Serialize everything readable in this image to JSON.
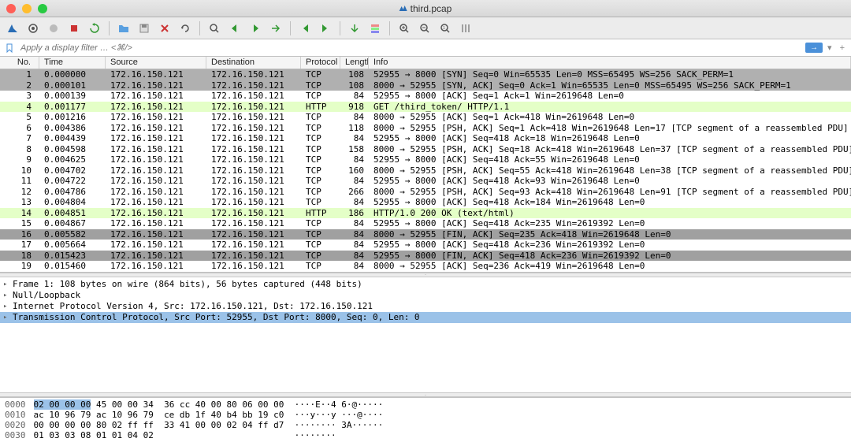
{
  "window": {
    "title": "third.pcap"
  },
  "filter": {
    "placeholder": "Apply a display filter … <⌘/>"
  },
  "toolbar_icons": [
    "shark-fin-icon",
    "capture-options-icon",
    "capture-start-icon",
    "capture-stop-icon",
    "capture-restart-icon",
    "sep",
    "file-open-icon",
    "file-save-icon",
    "file-close-icon",
    "reload-icon",
    "sep",
    "find-icon",
    "go-back-icon",
    "go-forward-icon",
    "go-to-icon",
    "sep",
    "go-first-icon",
    "go-last-icon",
    "sep",
    "auto-scroll-icon",
    "colorize-icon",
    "sep",
    "zoom-in-icon",
    "zoom-out-icon",
    "zoom-reset-icon",
    "resize-columns-icon"
  ],
  "columns": {
    "no": "No.",
    "time": "Time",
    "src": "Source",
    "dst": "Destination",
    "proto": "Protocol",
    "len": "Length",
    "info": "Info"
  },
  "packets": [
    {
      "no": 1,
      "time": "0.000000",
      "src": "172.16.150.121",
      "dst": "172.16.150.121",
      "proto": "TCP",
      "len": 108,
      "info": "52955 → 8000 [SYN] Seq=0 Win=65535 Len=0 MSS=65495 WS=256 SACK_PERM=1",
      "cls": "syn"
    },
    {
      "no": 2,
      "time": "0.000101",
      "src": "172.16.150.121",
      "dst": "172.16.150.121",
      "proto": "TCP",
      "len": 108,
      "info": "8000 → 52955 [SYN, ACK] Seq=0 Ack=1 Win=65535 Len=0 MSS=65495 WS=256 SACK_PERM=1",
      "cls": "syn"
    },
    {
      "no": 3,
      "time": "0.000139",
      "src": "172.16.150.121",
      "dst": "172.16.150.121",
      "proto": "TCP",
      "len": 84,
      "info": "52955 → 8000 [ACK] Seq=1 Ack=1 Win=2619648 Len=0",
      "cls": "default"
    },
    {
      "no": 4,
      "time": "0.001177",
      "src": "172.16.150.121",
      "dst": "172.16.150.121",
      "proto": "HTTP",
      "len": 918,
      "info": "GET /third_token/ HTTP/1.1",
      "cls": "http"
    },
    {
      "no": 5,
      "time": "0.001216",
      "src": "172.16.150.121",
      "dst": "172.16.150.121",
      "proto": "TCP",
      "len": 84,
      "info": "8000 → 52955 [ACK] Seq=1 Ack=418 Win=2619648 Len=0",
      "cls": "default"
    },
    {
      "no": 6,
      "time": "0.004386",
      "src": "172.16.150.121",
      "dst": "172.16.150.121",
      "proto": "TCP",
      "len": 118,
      "info": "8000 → 52955 [PSH, ACK] Seq=1 Ack=418 Win=2619648 Len=17 [TCP segment of a reassembled PDU]",
      "cls": "default"
    },
    {
      "no": 7,
      "time": "0.004439",
      "src": "172.16.150.121",
      "dst": "172.16.150.121",
      "proto": "TCP",
      "len": 84,
      "info": "52955 → 8000 [ACK] Seq=418 Ack=18 Win=2619648 Len=0",
      "cls": "default"
    },
    {
      "no": 8,
      "time": "0.004598",
      "src": "172.16.150.121",
      "dst": "172.16.150.121",
      "proto": "TCP",
      "len": 158,
      "info": "8000 → 52955 [PSH, ACK] Seq=18 Ack=418 Win=2619648 Len=37 [TCP segment of a reassembled PDU]",
      "cls": "default"
    },
    {
      "no": 9,
      "time": "0.004625",
      "src": "172.16.150.121",
      "dst": "172.16.150.121",
      "proto": "TCP",
      "len": 84,
      "info": "52955 → 8000 [ACK] Seq=418 Ack=55 Win=2619648 Len=0",
      "cls": "default"
    },
    {
      "no": 10,
      "time": "0.004702",
      "src": "172.16.150.121",
      "dst": "172.16.150.121",
      "proto": "TCP",
      "len": 160,
      "info": "8000 → 52955 [PSH, ACK] Seq=55 Ack=418 Win=2619648 Len=38 [TCP segment of a reassembled PDU]",
      "cls": "default"
    },
    {
      "no": 11,
      "time": "0.004722",
      "src": "172.16.150.121",
      "dst": "172.16.150.121",
      "proto": "TCP",
      "len": 84,
      "info": "52955 → 8000 [ACK] Seq=418 Ack=93 Win=2619648 Len=0",
      "cls": "default"
    },
    {
      "no": 12,
      "time": "0.004786",
      "src": "172.16.150.121",
      "dst": "172.16.150.121",
      "proto": "TCP",
      "len": 266,
      "info": "8000 → 52955 [PSH, ACK] Seq=93 Ack=418 Win=2619648 Len=91 [TCP segment of a reassembled PDU]",
      "cls": "default"
    },
    {
      "no": 13,
      "time": "0.004804",
      "src": "172.16.150.121",
      "dst": "172.16.150.121",
      "proto": "TCP",
      "len": 84,
      "info": "52955 → 8000 [ACK] Seq=418 Ack=184 Win=2619648 Len=0",
      "cls": "default"
    },
    {
      "no": 14,
      "time": "0.004851",
      "src": "172.16.150.121",
      "dst": "172.16.150.121",
      "proto": "HTTP",
      "len": 186,
      "info": "HTTP/1.0 200 OK  (text/html)",
      "cls": "http"
    },
    {
      "no": 15,
      "time": "0.004867",
      "src": "172.16.150.121",
      "dst": "172.16.150.121",
      "proto": "TCP",
      "len": 84,
      "info": "52955 → 8000 [ACK] Seq=418 Ack=235 Win=2619392 Len=0",
      "cls": "default"
    },
    {
      "no": 16,
      "time": "0.005582",
      "src": "172.16.150.121",
      "dst": "172.16.150.121",
      "proto": "TCP",
      "len": 84,
      "info": "8000 → 52955 [FIN, ACK] Seq=235 Ack=418 Win=2619648 Len=0",
      "cls": "fin"
    },
    {
      "no": 17,
      "time": "0.005664",
      "src": "172.16.150.121",
      "dst": "172.16.150.121",
      "proto": "TCP",
      "len": 84,
      "info": "52955 → 8000 [ACK] Seq=418 Ack=236 Win=2619392 Len=0",
      "cls": "default"
    },
    {
      "no": 18,
      "time": "0.015423",
      "src": "172.16.150.121",
      "dst": "172.16.150.121",
      "proto": "TCP",
      "len": 84,
      "info": "52955 → 8000 [FIN, ACK] Seq=418 Ack=236 Win=2619392 Len=0",
      "cls": "fin"
    },
    {
      "no": 19,
      "time": "0.015460",
      "src": "172.16.150.121",
      "dst": "172.16.150.121",
      "proto": "TCP",
      "len": 84,
      "info": "8000 → 52955 [ACK] Seq=236 Ack=419 Win=2619648 Len=0",
      "cls": "default"
    }
  ],
  "details": [
    {
      "text": "Frame 1: 108 bytes on wire (864 bits), 56 bytes captured (448 bits)",
      "selected": false
    },
    {
      "text": "Null/Loopback",
      "selected": false
    },
    {
      "text": "Internet Protocol Version 4, Src: 172.16.150.121, Dst: 172.16.150.121",
      "selected": false
    },
    {
      "text": "Transmission Control Protocol, Src Port: 52955, Dst Port: 8000, Seq: 0, Len: 0",
      "selected": true
    }
  ],
  "bytes": {
    "rows": [
      {
        "addr": "0000",
        "hex_pre": "",
        "hex_sel": "02 00 00 00",
        "hex_post": " 45 00 00 34  36 cc 40 00 80 06 00 00",
        "ascii": "····E··4 6·@·····"
      },
      {
        "addr": "0010",
        "hex_pre": "ac 10 96 79 ac 10 96 79  ce db 1f 40 b4 bb 19 c0",
        "hex_sel": "",
        "hex_post": "",
        "ascii": "···y···y ···@····"
      },
      {
        "addr": "0020",
        "hex_pre": "00 00 00 00 80 02 ff ff  33 41 00 00 02 04 ff d7",
        "hex_sel": "",
        "hex_post": "",
        "ascii": "········ 3A······"
      },
      {
        "addr": "0030",
        "hex_pre": "01 03 03 08 01 01 04 02",
        "hex_sel": "",
        "hex_post": "",
        "ascii": "········"
      }
    ]
  }
}
